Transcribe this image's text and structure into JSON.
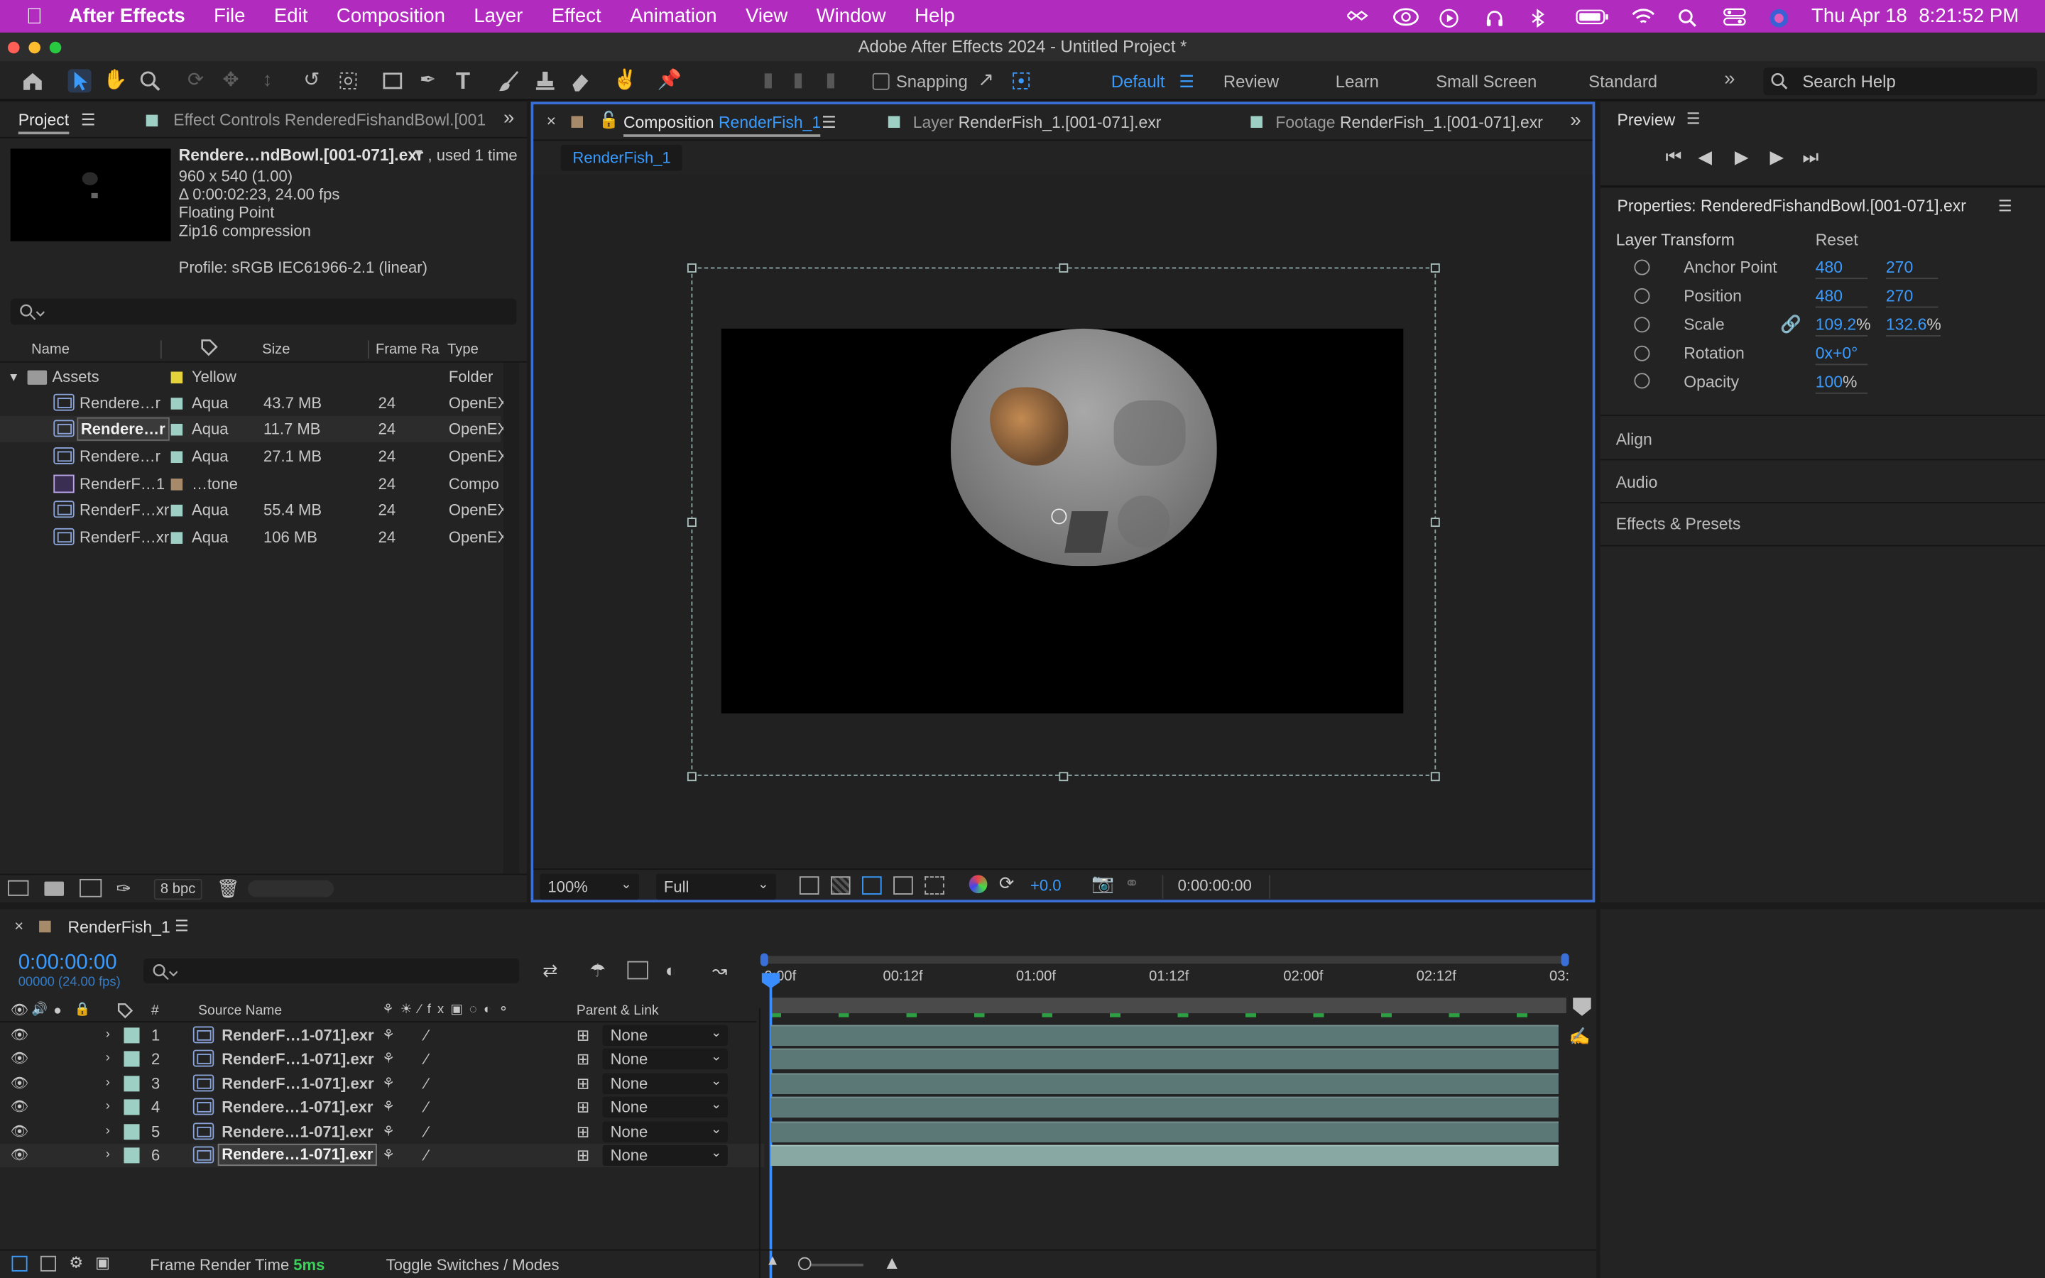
{
  "menubar": {
    "app_name": "After Effects",
    "items": [
      "File",
      "Edit",
      "Composition",
      "Layer",
      "Effect",
      "Animation",
      "View",
      "Window",
      "Help"
    ],
    "date": "Thu Apr 18",
    "time": "8:21:52 PM"
  },
  "window": {
    "title": "Adobe After Effects 2024 - Untitled Project *"
  },
  "toolbar": {
    "snapping_label": "Snapping",
    "workspaces": [
      "Default",
      "Review",
      "Learn",
      "Small Screen",
      "Standard"
    ],
    "active_workspace": "Default",
    "search_placeholder": "Search Help"
  },
  "project_panel": {
    "tab_project": "Project",
    "tab_effect_controls": "Effect Controls RenderedFishandBowl.[001",
    "info": {
      "name": "Rendere…ndBowl.[001-071].exr",
      "used": ", used 1 time",
      "dimensions": "960 x 540 (1.00)",
      "duration": "Δ 0:00:02:23, 24.00 fps",
      "depth": "Floating Point",
      "compression": "Zip16 compression",
      "profile": "Profile: sRGB IEC61966-2.1 (linear)"
    },
    "search_placeholder": "",
    "columns": [
      "Name",
      "Size",
      "Frame Ra",
      "Type"
    ],
    "rows": [
      {
        "name": "Assets",
        "label": "Yellow",
        "size": "",
        "fps": "",
        "type": "Folder",
        "color": "#e3d23a"
      },
      {
        "name": "Rendere…r",
        "label": "Aqua",
        "size": "43.7 MB",
        "fps": "24",
        "type": "OpenEX",
        "color": "#9ecfc4"
      },
      {
        "name": "Rendere…r",
        "label": "Aqua",
        "size": "11.7 MB",
        "fps": "24",
        "type": "OpenEX",
        "color": "#9ecfc4"
      },
      {
        "name": "Rendere…r",
        "label": "Aqua",
        "size": "27.1 MB",
        "fps": "24",
        "type": "OpenEX",
        "color": "#9ecfc4"
      },
      {
        "name": "RenderF…1",
        "label": "…tone",
        "size": "",
        "fps": "24",
        "type": "Compo",
        "color": "#a78a6a"
      },
      {
        "name": "RenderF…xr",
        "label": "Aqua",
        "size": "55.4 MB",
        "fps": "24",
        "type": "OpenEX",
        "color": "#9ecfc4"
      },
      {
        "name": "RenderF…xr",
        "label": "Aqua",
        "size": "106 MB",
        "fps": "24",
        "type": "OpenEX",
        "color": "#9ecfc4"
      }
    ],
    "bpc": "8 bpc"
  },
  "comp_panel": {
    "tab_comp_prefix": "Composition",
    "tab_comp_name": "RenderFish_1",
    "tab_layer_prefix": "Layer",
    "tab_layer_name": "RenderFish_1.[001-071].exr",
    "tab_footage_prefix": "Footage",
    "tab_footage_name": "RenderFish_1.[001-071].exr",
    "breadcrumb": "RenderFish_1",
    "zoom": "100%",
    "resolution": "Full",
    "exposure": "+0.0",
    "timecode": "0:00:00:00"
  },
  "preview_panel": {
    "title": "Preview"
  },
  "properties_panel": {
    "title": "Properties: RenderedFishandBowl.[001-071].exr",
    "section": "Layer Transform",
    "reset": "Reset",
    "props": [
      {
        "name": "Anchor Point",
        "v1": "480",
        "v2": "270"
      },
      {
        "name": "Position",
        "v1": "480",
        "v2": "270"
      },
      {
        "name": "Scale",
        "v1": "109.2",
        "v2": "132.6",
        "unit": "%"
      },
      {
        "name": "Rotation",
        "v1": "0x+0°",
        "v2": ""
      },
      {
        "name": "Opacity",
        "v1": "100",
        "v2": "",
        "unit": "%"
      }
    ],
    "collapsed": [
      "Align",
      "Audio",
      "Effects & Presets"
    ]
  },
  "timeline": {
    "comp_name": "RenderFish_1",
    "timecode": "0:00:00:00",
    "frame_info": "00000 (24.00 fps)",
    "columns": {
      "num": "#",
      "source": "Source Name",
      "parent": "Parent & Link"
    },
    "ruler": [
      "0:00f",
      "00:12f",
      "01:00f",
      "01:12f",
      "02:00f",
      "02:12f",
      "03:"
    ],
    "layers": [
      {
        "num": "1",
        "name": "RenderF…1-071].exr",
        "parent": "None"
      },
      {
        "num": "2",
        "name": "RenderF…1-071].exr",
        "parent": "None"
      },
      {
        "num": "3",
        "name": "RenderF…1-071].exr",
        "parent": "None"
      },
      {
        "num": "4",
        "name": "Rendere…1-071].exr",
        "parent": "None"
      },
      {
        "num": "5",
        "name": "Rendere…1-071].exr",
        "parent": "None"
      },
      {
        "num": "6",
        "name": "Rendere…1-071].exr",
        "parent": "None"
      }
    ],
    "footer_label": "Frame Render Time",
    "footer_value": "5ms",
    "toggle": "Toggle Switches / Modes"
  }
}
